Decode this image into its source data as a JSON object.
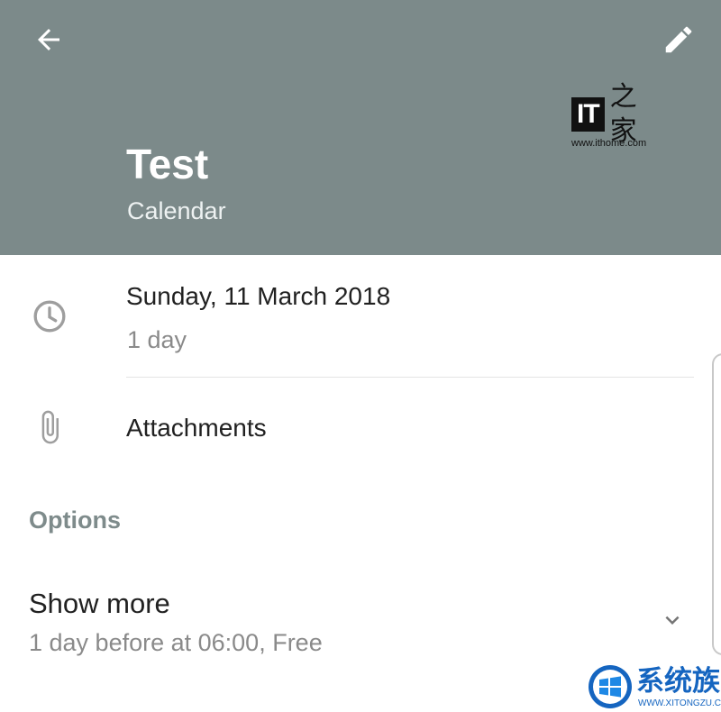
{
  "header": {
    "title": "Test",
    "calendar": "Calendar",
    "background_color": "#7c8a8a",
    "back_icon": "arrow-back-icon",
    "edit_icon": "pencil-edit-icon"
  },
  "watermark_top": {
    "logo_text": "IT",
    "logo_glyph": "之家",
    "url": "www.ithome.com"
  },
  "event": {
    "date": "Sunday, 11 March 2018",
    "duration": "1 day",
    "time_icon": "clock-icon"
  },
  "attachments": {
    "label": "Attachments",
    "icon": "paperclip-icon"
  },
  "options": {
    "heading": "Options",
    "show_more": {
      "title": "Show more",
      "subtitle": "1 day before at 06:00, Free",
      "icon": "chevron-down-icon"
    }
  },
  "watermark_bottom": {
    "title": "系统族",
    "url": "WWW.XITONGZU.COM"
  },
  "colors": {
    "icon_gray": "#9e9e9e",
    "accent_gray": "#7e8b8b",
    "primary_text": "#212121",
    "secondary_text": "#8a8a8a"
  }
}
